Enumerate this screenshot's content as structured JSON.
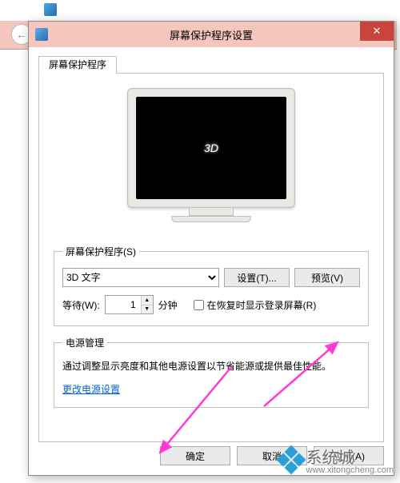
{
  "dialog": {
    "title": "屏幕保护程序设置",
    "close_icon": "✕",
    "tab_label": "屏幕保护程序"
  },
  "preview": {
    "text": "3D"
  },
  "saver": {
    "legend": "屏幕保护程序(S)",
    "selected": "3D 文字",
    "settings_btn": "设置(T)...",
    "preview_btn": "预览(V)",
    "wait_label": "等待(W):",
    "wait_value": "1",
    "wait_unit": "分钟",
    "resume_checkbox": "在恢复时显示登录屏幕(R)"
  },
  "power": {
    "legend": "电源管理",
    "description": "通过调整显示亮度和其他电源设置以节省能源或提供最佳性能。",
    "link": "更改电源设置"
  },
  "buttons": {
    "ok": "确定",
    "cancel": "取消",
    "apply": "应用(A)"
  },
  "watermark": {
    "brand": "系统城",
    "url": "www.xitongcheng.com"
  }
}
